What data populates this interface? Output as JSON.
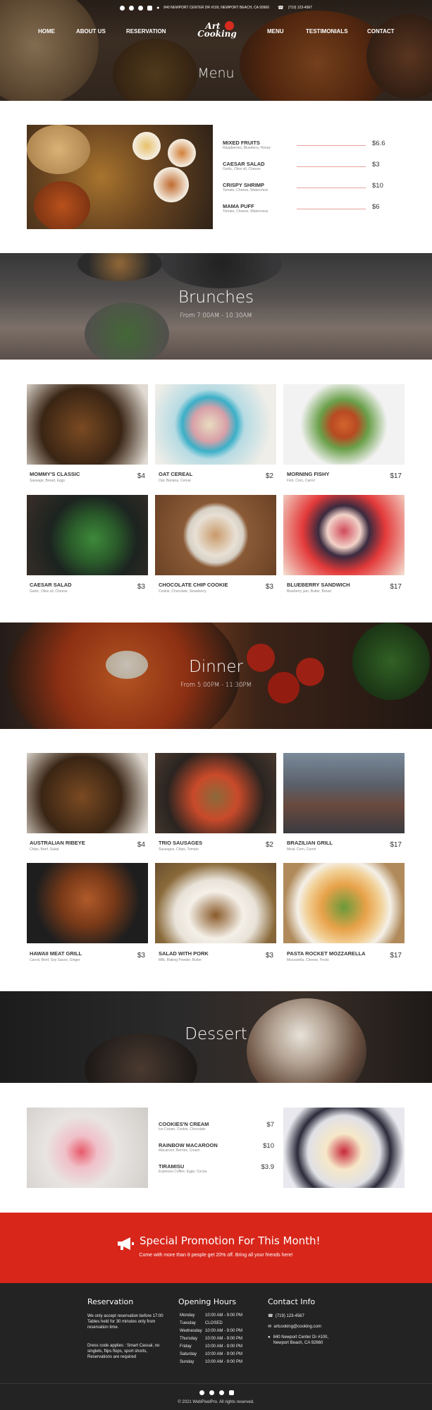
{
  "topbar": {
    "address": "840 NEWPORT CENTER DR #100, NEWPORT BEACH, CA 92660",
    "phone": "(719) 123-4567"
  },
  "nav": {
    "home": "HOME",
    "about": "ABOUT US",
    "reservation": "RESERVATION",
    "menu": "MENU",
    "testimonials": "TESTIMONIALS",
    "contact": "CONTACT"
  },
  "logo": {
    "line1": "Art",
    "line2": "Cooking"
  },
  "page_title": "Menu",
  "starters": [
    {
      "name": "MIXED FRUITS",
      "desc": "Raspberries, Blueberry, Honey",
      "price": "$6.6"
    },
    {
      "name": "CAESAR SALAD",
      "desc": "Garlic, Olive oil, Cheese",
      "price": "$3"
    },
    {
      "name": "CRISPY SHRIMP",
      "desc": "Tomato, Cheese, Watercress",
      "price": "$10"
    },
    {
      "name": "MAMA PUFF",
      "desc": "Tomato, Cheese, Watercress",
      "price": "$6"
    }
  ],
  "brunches": {
    "title": "Brunches",
    "subtitle": "From 7:00AM - 10:30AM",
    "items": [
      {
        "name": "MOMMY'S CLASSIC",
        "desc": "Sausage, Bread, Eggs",
        "price": "$4"
      },
      {
        "name": "OAT CEREAL",
        "desc": "Oat, Banana, Cereal",
        "price": "$2"
      },
      {
        "name": "MORNING FISHY",
        "desc": "Fish, Corn, Carrot",
        "price": "$17"
      },
      {
        "name": "CAESAR SALAD",
        "desc": "Garlic, Olive oil, Cheese",
        "price": "$3"
      },
      {
        "name": "CHOCOLATE CHIP COOKIE",
        "desc": "Cookie, Chocolate, Strawberry",
        "price": "$3"
      },
      {
        "name": "BLUEBERRY SANDWICH",
        "desc": "Blueberry jam, Butter, Bread",
        "price": "$17"
      }
    ]
  },
  "dinner": {
    "title": "Dinner",
    "subtitle": "From 5:00PM - 11:30PM",
    "items": [
      {
        "name": "AUSTRALIAN RIBEYE",
        "desc": "Chips, Beef, Salad",
        "price": "$4"
      },
      {
        "name": "TRIO SAUSAGES",
        "desc": "Sausages, Chips, Tomato",
        "price": "$2"
      },
      {
        "name": "BRAZILIAN GRILL",
        "desc": "Meat, Corn, Carrot",
        "price": "$17"
      },
      {
        "name": "HAWAII MEAT GRILL",
        "desc": "Carrot, Beef, Soy Sauce, Ginger",
        "price": "$3"
      },
      {
        "name": "SALAD WITH PORK",
        "desc": "Milk, Baking Powder, Butter",
        "price": "$3"
      },
      {
        "name": "PASTA ROCKET MOZZARELLA",
        "desc": "Mozzarella, Cheese, Pesto",
        "price": "$17"
      }
    ]
  },
  "dessert": {
    "title": "Dessert",
    "items": [
      {
        "name": "COOKIES'N CREAM",
        "desc": "Ice Cream, Cookie, Chocolate",
        "price": "$7"
      },
      {
        "name": "RAINBOW MACAROON",
        "desc": "Macaroon, Berries, Cream",
        "price": "$10"
      },
      {
        "name": "TIRAMISU",
        "desc": "Espresso Coffee, Eggs, Cocoa",
        "price": "$3.9"
      }
    ]
  },
  "promo": {
    "title": "Special Promotion For This Month!",
    "text": "Come with more than 8 people get 20% off. Bring all your friends here!"
  },
  "footer": {
    "reservation_title": "Reservation",
    "reservation_text1": "We only accept reservation before 17:00 Tables held for 30 minutes only from reservation time.",
    "reservation_text2": "Dress code applies : Smart Casual, no singlets, flips flops, sport shorts, Reservations are required",
    "hours_title": "Opening Hours",
    "hours": [
      {
        "day": "Monday",
        "time": "10:00 AM - 9:00 PM"
      },
      {
        "day": "Tuesday",
        "time": "CLOSED"
      },
      {
        "day": "Wednesday",
        "time": "10:00 AM - 9:00 PM"
      },
      {
        "day": "Thursday",
        "time": "10:00 AM - 9:00 PM"
      },
      {
        "day": "Friday",
        "time": "10:00 AM - 9:00 PM"
      },
      {
        "day": "Saturday",
        "time": "10:00 AM - 9:00 PM"
      },
      {
        "day": "Sunday",
        "time": "10:00 AM - 9:00 PM"
      }
    ],
    "contact_title": "Contact Info",
    "phone": "(719) 123-4567",
    "email": "artcooking@cooking.com",
    "address": "840 Newport Center Dr #100, Newport Beach, CA 92660",
    "copyright": "© 2021 WebPixelPro. All rights reserved."
  },
  "colors": {
    "accent": "#d8261b",
    "footer_bg": "#232323",
    "line": "#e6a39c"
  }
}
